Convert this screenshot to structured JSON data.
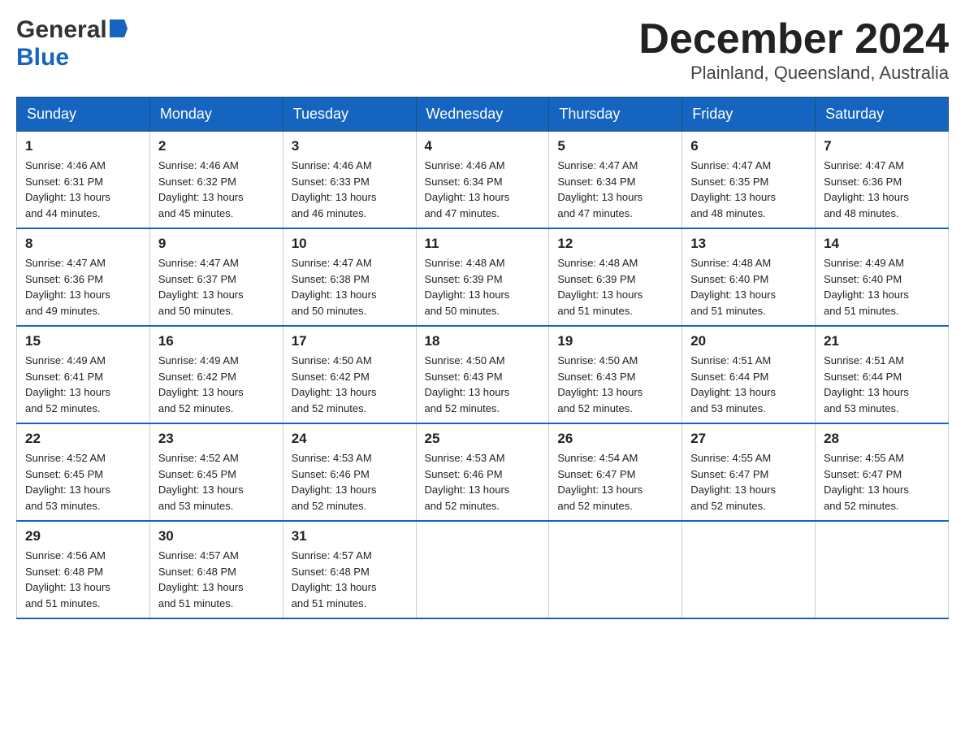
{
  "header": {
    "logo_general": "General",
    "logo_blue": "Blue",
    "month_title": "December 2024",
    "location": "Plainland, Queensland, Australia"
  },
  "days_of_week": [
    "Sunday",
    "Monday",
    "Tuesday",
    "Wednesday",
    "Thursday",
    "Friday",
    "Saturday"
  ],
  "weeks": [
    [
      {
        "day": "1",
        "sunrise": "4:46 AM",
        "sunset": "6:31 PM",
        "daylight": "13 hours and 44 minutes."
      },
      {
        "day": "2",
        "sunrise": "4:46 AM",
        "sunset": "6:32 PM",
        "daylight": "13 hours and 45 minutes."
      },
      {
        "day": "3",
        "sunrise": "4:46 AM",
        "sunset": "6:33 PM",
        "daylight": "13 hours and 46 minutes."
      },
      {
        "day": "4",
        "sunrise": "4:46 AM",
        "sunset": "6:34 PM",
        "daylight": "13 hours and 47 minutes."
      },
      {
        "day": "5",
        "sunrise": "4:47 AM",
        "sunset": "6:34 PM",
        "daylight": "13 hours and 47 minutes."
      },
      {
        "day": "6",
        "sunrise": "4:47 AM",
        "sunset": "6:35 PM",
        "daylight": "13 hours and 48 minutes."
      },
      {
        "day": "7",
        "sunrise": "4:47 AM",
        "sunset": "6:36 PM",
        "daylight": "13 hours and 48 minutes."
      }
    ],
    [
      {
        "day": "8",
        "sunrise": "4:47 AM",
        "sunset": "6:36 PM",
        "daylight": "13 hours and 49 minutes."
      },
      {
        "day": "9",
        "sunrise": "4:47 AM",
        "sunset": "6:37 PM",
        "daylight": "13 hours and 50 minutes."
      },
      {
        "day": "10",
        "sunrise": "4:47 AM",
        "sunset": "6:38 PM",
        "daylight": "13 hours and 50 minutes."
      },
      {
        "day": "11",
        "sunrise": "4:48 AM",
        "sunset": "6:39 PM",
        "daylight": "13 hours and 50 minutes."
      },
      {
        "day": "12",
        "sunrise": "4:48 AM",
        "sunset": "6:39 PM",
        "daylight": "13 hours and 51 minutes."
      },
      {
        "day": "13",
        "sunrise": "4:48 AM",
        "sunset": "6:40 PM",
        "daylight": "13 hours and 51 minutes."
      },
      {
        "day": "14",
        "sunrise": "4:49 AM",
        "sunset": "6:40 PM",
        "daylight": "13 hours and 51 minutes."
      }
    ],
    [
      {
        "day": "15",
        "sunrise": "4:49 AM",
        "sunset": "6:41 PM",
        "daylight": "13 hours and 52 minutes."
      },
      {
        "day": "16",
        "sunrise": "4:49 AM",
        "sunset": "6:42 PM",
        "daylight": "13 hours and 52 minutes."
      },
      {
        "day": "17",
        "sunrise": "4:50 AM",
        "sunset": "6:42 PM",
        "daylight": "13 hours and 52 minutes."
      },
      {
        "day": "18",
        "sunrise": "4:50 AM",
        "sunset": "6:43 PM",
        "daylight": "13 hours and 52 minutes."
      },
      {
        "day": "19",
        "sunrise": "4:50 AM",
        "sunset": "6:43 PM",
        "daylight": "13 hours and 52 minutes."
      },
      {
        "day": "20",
        "sunrise": "4:51 AM",
        "sunset": "6:44 PM",
        "daylight": "13 hours and 53 minutes."
      },
      {
        "day": "21",
        "sunrise": "4:51 AM",
        "sunset": "6:44 PM",
        "daylight": "13 hours and 53 minutes."
      }
    ],
    [
      {
        "day": "22",
        "sunrise": "4:52 AM",
        "sunset": "6:45 PM",
        "daylight": "13 hours and 53 minutes."
      },
      {
        "day": "23",
        "sunrise": "4:52 AM",
        "sunset": "6:45 PM",
        "daylight": "13 hours and 53 minutes."
      },
      {
        "day": "24",
        "sunrise": "4:53 AM",
        "sunset": "6:46 PM",
        "daylight": "13 hours and 52 minutes."
      },
      {
        "day": "25",
        "sunrise": "4:53 AM",
        "sunset": "6:46 PM",
        "daylight": "13 hours and 52 minutes."
      },
      {
        "day": "26",
        "sunrise": "4:54 AM",
        "sunset": "6:47 PM",
        "daylight": "13 hours and 52 minutes."
      },
      {
        "day": "27",
        "sunrise": "4:55 AM",
        "sunset": "6:47 PM",
        "daylight": "13 hours and 52 minutes."
      },
      {
        "day": "28",
        "sunrise": "4:55 AM",
        "sunset": "6:47 PM",
        "daylight": "13 hours and 52 minutes."
      }
    ],
    [
      {
        "day": "29",
        "sunrise": "4:56 AM",
        "sunset": "6:48 PM",
        "daylight": "13 hours and 51 minutes."
      },
      {
        "day": "30",
        "sunrise": "4:57 AM",
        "sunset": "6:48 PM",
        "daylight": "13 hours and 51 minutes."
      },
      {
        "day": "31",
        "sunrise": "4:57 AM",
        "sunset": "6:48 PM",
        "daylight": "13 hours and 51 minutes."
      },
      null,
      null,
      null,
      null
    ]
  ],
  "labels": {
    "sunrise": "Sunrise:",
    "sunset": "Sunset:",
    "daylight": "Daylight:"
  }
}
